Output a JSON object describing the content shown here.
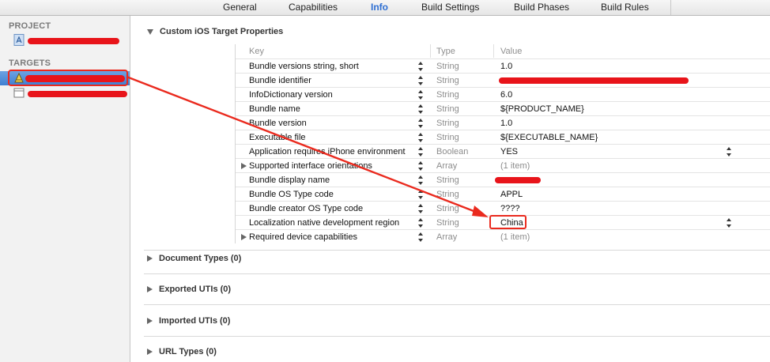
{
  "tabs": [
    "General",
    "Capabilities",
    "Info",
    "Build Settings",
    "Build Phases",
    "Build Rules"
  ],
  "active_tab": "Info",
  "sidebar": {
    "project_header": "PROJECT",
    "targets_header": "TARGETS"
  },
  "sections": {
    "custom": "Custom iOS Target Properties",
    "document_types": "Document Types (0)",
    "exported_utis": "Exported UTIs (0)",
    "imported_utis": "Imported UTIs (0)",
    "url_types": "URL Types (0)"
  },
  "table": {
    "headers": {
      "key": "Key",
      "type": "Type",
      "value": "Value"
    },
    "rows": [
      {
        "key": "Bundle versions string, short",
        "type": "String",
        "value": "1.0"
      },
      {
        "key": "Bundle identifier",
        "type": "String",
        "value": ""
      },
      {
        "key": "InfoDictionary version",
        "type": "String",
        "value": "6.0"
      },
      {
        "key": "Bundle name",
        "type": "String",
        "value": "${PRODUCT_NAME}"
      },
      {
        "key": "Bundle version",
        "type": "String",
        "value": "1.0"
      },
      {
        "key": "Executable file",
        "type": "String",
        "value": "${EXECUTABLE_NAME}"
      },
      {
        "key": "Application requires iPhone environment",
        "type": "Boolean",
        "value": "YES"
      },
      {
        "key": "Supported interface orientations",
        "type": "Array",
        "value": "(1 item)"
      },
      {
        "key": "Bundle display name",
        "type": "String",
        "value": ""
      },
      {
        "key": "Bundle OS Type code",
        "type": "String",
        "value": "APPL"
      },
      {
        "key": "Bundle creator OS Type code",
        "type": "String",
        "value": "????"
      },
      {
        "key": "Localization native development region",
        "type": "String",
        "value": "China"
      },
      {
        "key": "Required device capabilities",
        "type": "Array",
        "value": "(1 item)"
      }
    ]
  },
  "colors": {
    "accent": "#2e6fd3",
    "selection": "#4a86d6",
    "annotation": "#ea2a1e"
  }
}
